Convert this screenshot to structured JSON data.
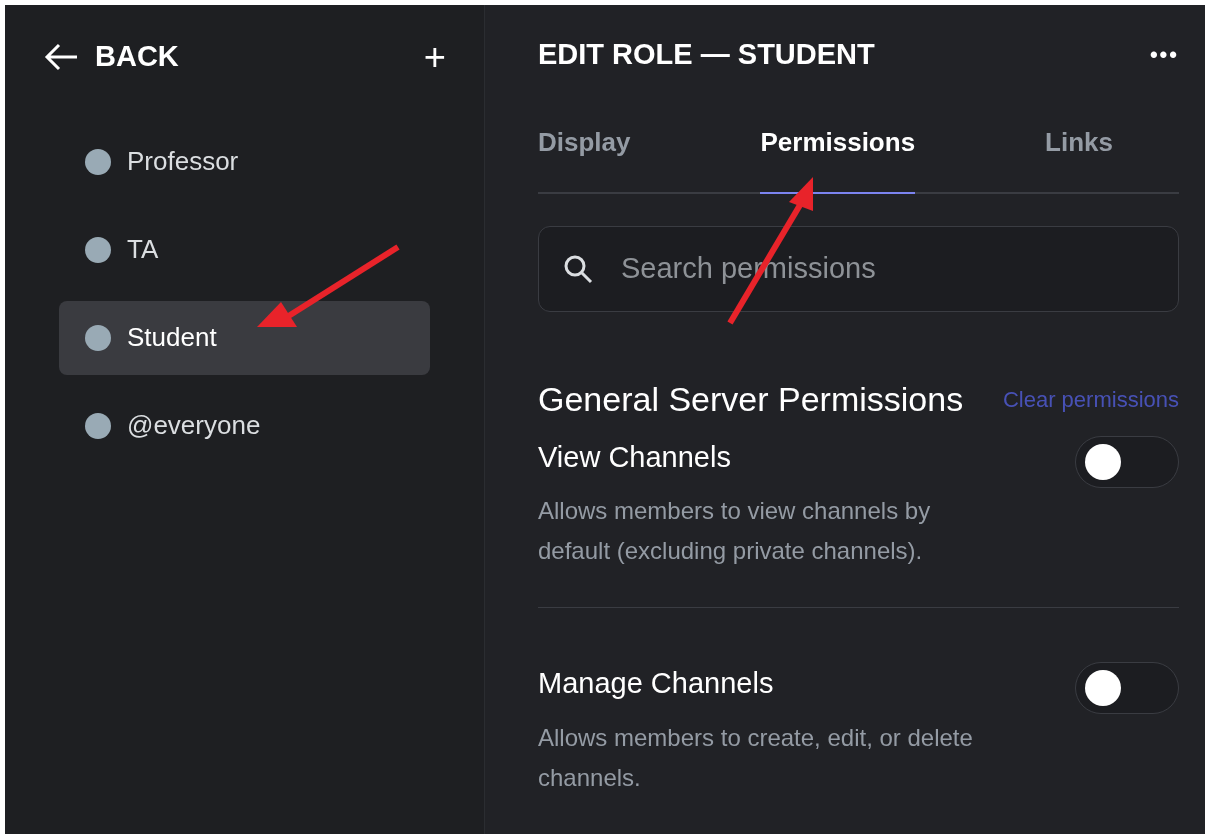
{
  "sidebar": {
    "back_label": "BACK",
    "add_label": "+",
    "roles": [
      {
        "name": "Professor",
        "color": "#99aab5",
        "selected": false
      },
      {
        "name": "TA",
        "color": "#99aab5",
        "selected": false
      },
      {
        "name": "Student",
        "color": "#99aab5",
        "selected": true
      },
      {
        "name": "@everyone",
        "color": "#99aab5",
        "selected": false
      }
    ]
  },
  "header": {
    "title": "EDIT ROLE — STUDENT",
    "more_label": "•••"
  },
  "tabs": [
    {
      "label": "Display",
      "selected": false
    },
    {
      "label": "Permissions",
      "selected": true
    },
    {
      "label": "Links",
      "selected": false
    }
  ],
  "search": {
    "placeholder": "Search permissions"
  },
  "section": {
    "title": "General Server Permissions",
    "clear_label": "Clear permissions"
  },
  "permissions": [
    {
      "name": "View Channels",
      "description": "Allows members to view channels by default (excluding private channels).",
      "on": false
    },
    {
      "name": "Manage Channels",
      "description": "Allows members to create, edit, or delete channels.",
      "on": false
    }
  ]
}
